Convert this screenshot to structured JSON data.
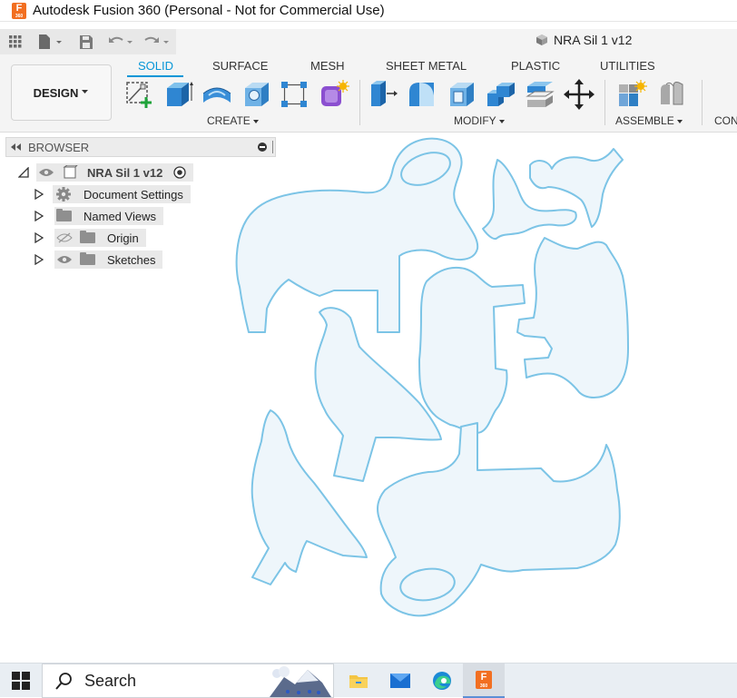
{
  "window": {
    "title": "Autodesk Fusion 360 (Personal - Not for Commercial Use)",
    "app_logo_letter": "F",
    "app_logo_sub": "360"
  },
  "document_tab": {
    "name": "NRA Sil 1 v12"
  },
  "workspace": {
    "label": "DESIGN"
  },
  "ribbon_tabs": [
    "SOLID",
    "SURFACE",
    "MESH",
    "SHEET METAL",
    "PLASTIC",
    "UTILITIES"
  ],
  "ribbon_groups": {
    "create": "CREATE",
    "modify": "MODIFY",
    "assemble": "ASSEMBLE",
    "construct": "CONS"
  },
  "browser": {
    "title": "BROWSER",
    "root": "NRA Sil 1 v12",
    "items": [
      "Document Settings",
      "Named Views",
      "Origin",
      "Sketches"
    ]
  },
  "taskbar": {
    "search_label": "Search"
  },
  "colors": {
    "accent": "#0696d7",
    "sketch_fill": "#eef6fb",
    "sketch_stroke": "#7cc4e6",
    "fusion_orange": "#f26f21"
  }
}
